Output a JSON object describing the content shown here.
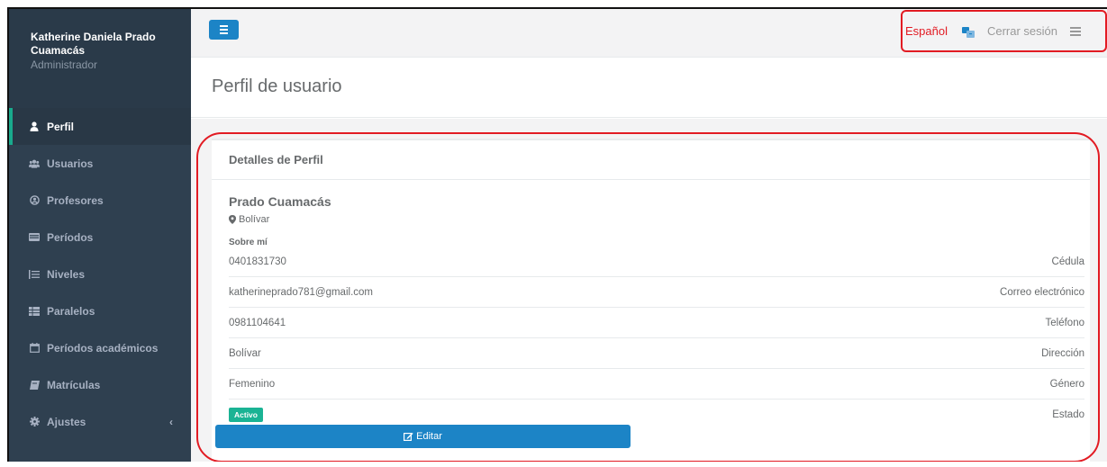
{
  "sidebar": {
    "user_name": "Katherine Daniela Prado Cuamacás",
    "user_role": "Administrador",
    "items": [
      {
        "label": "Perfil",
        "icon": "user-icon"
      },
      {
        "label": "Usuarios",
        "icon": "users-icon"
      },
      {
        "label": "Profesores",
        "icon": "user-circle-icon"
      },
      {
        "label": "Períodos",
        "icon": "card-icon"
      },
      {
        "label": "Niveles",
        "icon": "list-ol-icon"
      },
      {
        "label": "Paralelos",
        "icon": "table-icon"
      },
      {
        "label": "Períodos académicos",
        "icon": "calendar-icon"
      },
      {
        "label": "Matrículas",
        "icon": "book-icon"
      },
      {
        "label": "Ajustes",
        "icon": "gear-icon"
      }
    ],
    "active_item": "Perfil"
  },
  "topbar": {
    "language": "Español",
    "logout": "Cerrar sesión"
  },
  "page": {
    "title": "Perfil de usuario"
  },
  "profile": {
    "panel_title": "Detalles de Perfil",
    "name": "Prado Cuamacás",
    "location": "Bolívar",
    "about_label": "Sobre mí",
    "rows": [
      {
        "value": "0401831730",
        "label": "Cédula"
      },
      {
        "value": "katherineprado781@gmail.com",
        "label": "Correo electrónico"
      },
      {
        "value": "0981104641",
        "label": "Teléfono"
      },
      {
        "value": "Bolívar",
        "label": "Dirección"
      },
      {
        "value": "Femenino",
        "label": "Género"
      }
    ],
    "status_badge": "Activo",
    "status_label": "Estado",
    "edit_button": "Editar"
  },
  "colors": {
    "sidebar": "#2f4050",
    "accent_green": "#1ab394",
    "primary_blue": "#1c84c6",
    "annotation_red": "#e21b23"
  }
}
